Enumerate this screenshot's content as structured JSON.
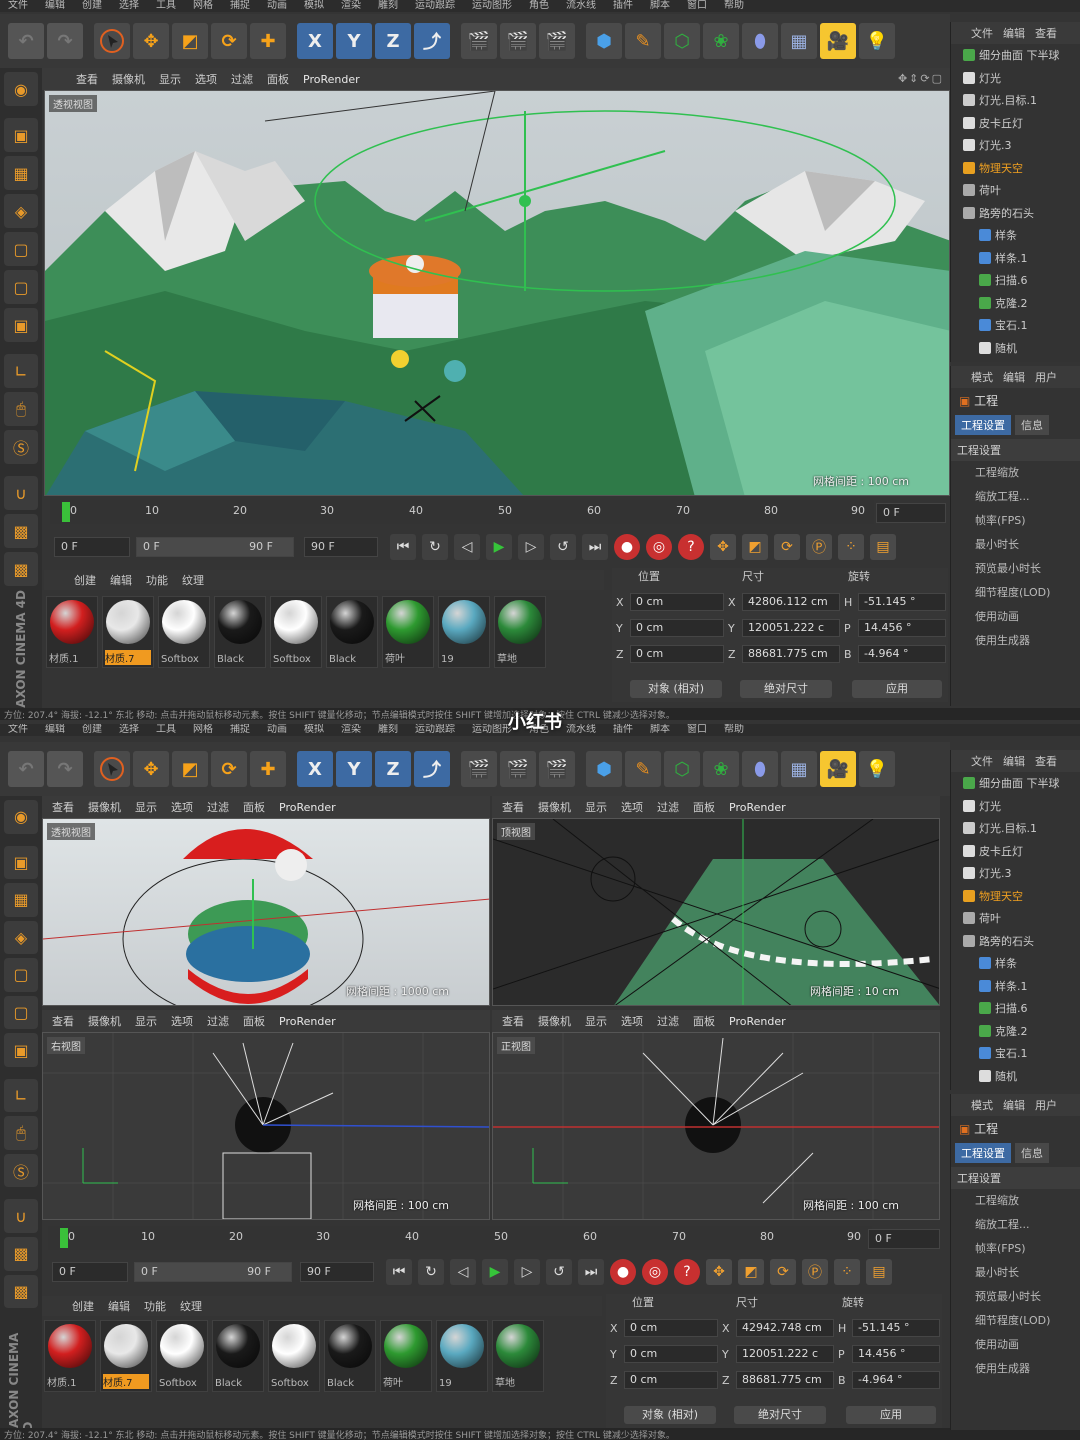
{
  "menu": [
    "文件",
    "编辑",
    "创建",
    "选择",
    "工具",
    "网格",
    "捕捉",
    "动画",
    "模拟",
    "渲染",
    "雕刻",
    "运动跟踪",
    "运动图形",
    "角色",
    "流水线",
    "插件",
    "脚本",
    "窗口",
    "帮助"
  ],
  "toolbar_axes": [
    "X",
    "Y",
    "Z"
  ],
  "viewport_menu": [
    "查看",
    "摄像机",
    "显示",
    "选项",
    "过滤",
    "面板",
    "ProRender"
  ],
  "right_menu": [
    "文件",
    "编辑",
    "查看"
  ],
  "attr_menu": [
    "模式",
    "编辑",
    "用户"
  ],
  "top": {
    "viewport_label": "透视视图",
    "grid_label": "网格间距 : 100 cm"
  },
  "bottom": {
    "viewports": [
      {
        "label": "透视视图",
        "grid": "网格间距 : 1000 cm"
      },
      {
        "label": "顶视图",
        "grid": "网格间距 : 10 cm"
      },
      {
        "label": "右视图",
        "grid": "网格间距 : 100 cm"
      },
      {
        "label": "正视图",
        "grid": "网格间距 : 100 cm"
      }
    ]
  },
  "timeline": {
    "ticks": [
      "0",
      "10",
      "20",
      "30",
      "40",
      "50",
      "60",
      "70",
      "80",
      "90"
    ],
    "current": "0 F",
    "start": "0 F",
    "range_start": "0 F",
    "range_end": "90 F",
    "end": "90 F"
  },
  "materials_menu": [
    "创建",
    "编辑",
    "功能",
    "纹理"
  ],
  "materials": [
    {
      "name": "材质.1",
      "color": "#d21f1f"
    },
    {
      "name": "材质.7",
      "color": "#e8e8e8",
      "selected": true
    },
    {
      "name": "Softbox",
      "color": "#ffffff"
    },
    {
      "name": "Black",
      "color": "#1a1a1a"
    },
    {
      "name": "Softbox",
      "color": "#ffffff"
    },
    {
      "name": "Black",
      "color": "#1a1a1a"
    },
    {
      "name": "荷叶",
      "color": "#2e9a30"
    },
    {
      "name": "19",
      "color": "#5aa9c0"
    },
    {
      "name": "草地",
      "color": "#2c8a3a"
    }
  ],
  "coords": {
    "headers": [
      "位置",
      "尺寸",
      "旋转"
    ],
    "rows_top": [
      {
        "axis": "X",
        "pos": "0 cm",
        "size_axis": "X",
        "size": "42806.112 cm",
        "rot_axis": "H",
        "rot": "-51.145 °"
      },
      {
        "axis": "Y",
        "pos": "0 cm",
        "size_axis": "Y",
        "size": "120051.222 c",
        "rot_axis": "P",
        "rot": "14.456 °"
      },
      {
        "axis": "Z",
        "pos": "0 cm",
        "size_axis": "Z",
        "size": "88681.775 cm",
        "rot_axis": "B",
        "rot": "-4.964 °"
      }
    ],
    "rows_bottom": [
      {
        "axis": "X",
        "pos": "0 cm",
        "size_axis": "X",
        "size": "42942.748 cm",
        "rot_axis": "H",
        "rot": "-51.145 °"
      },
      {
        "axis": "Y",
        "pos": "0 cm",
        "size_axis": "Y",
        "size": "120051.222 c",
        "rot_axis": "P",
        "rot": "14.456 °"
      },
      {
        "axis": "Z",
        "pos": "0 cm",
        "size_axis": "Z",
        "size": "88681.775 cm",
        "rot_axis": "B",
        "rot": "-4.964 °"
      }
    ],
    "mode_btn": "对象 (相对)",
    "size_btn": "绝对尺寸",
    "apply_btn": "应用"
  },
  "objects": [
    {
      "name": "细分曲面 下半球",
      "icon": "#4aa84a"
    },
    {
      "name": "灯光",
      "icon": "#dddddd"
    },
    {
      "name": "灯光.目标.1",
      "icon": "#cccccc"
    },
    {
      "name": "皮卡丘灯",
      "icon": "#dddddd"
    },
    {
      "name": "灯光.3",
      "icon": "#dddddd"
    },
    {
      "name": "物理天空",
      "icon": "#e8a020",
      "highlight": true
    },
    {
      "name": "荷叶",
      "icon": "#aaaaaa"
    },
    {
      "name": "路旁的石头",
      "icon": "#aaaaaa"
    },
    {
      "name": "样条",
      "icon": "#4a8ad8"
    },
    {
      "name": "样条.1",
      "icon": "#4a8ad8"
    },
    {
      "name": "扫描.6",
      "icon": "#4aa84a"
    },
    {
      "name": "克隆.2",
      "icon": "#4aa84a"
    },
    {
      "name": "宝石.1",
      "icon": "#4a8ad8"
    },
    {
      "name": "随机",
      "icon": "#dddddd"
    }
  ],
  "attributes": {
    "title": "工程",
    "tabs": [
      "工程设置",
      "信息"
    ],
    "section": "工程设置",
    "rows": [
      "工程缩放",
      "缩放工程...",
      "帧率(FPS)",
      "最小时长",
      "预览最小时长",
      "细节程度(LOD)",
      "使用动画",
      "使用生成器"
    ]
  },
  "status_top": "方位: 207.4°  海拔: -12.1°  东北     移动: 点击并拖动鼠标移动元素。按住 SHIFT 键量化移动；节点编辑模式时按住 SHIFT 键增加选择对象；按住 CTRL 键减少选择对象。",
  "status_bottom": "方位: 207.4°  海拔: -12.1°  东北     移动: 点击并拖动鼠标移动元素。按住 SHIFT 键量化移动；节点编辑模式时按住 SHIFT 键增加选择对象；按住 CTRL 键减少选择对象。",
  "watermark": "小红书",
  "logo": "MAXON CINEMA 4D"
}
